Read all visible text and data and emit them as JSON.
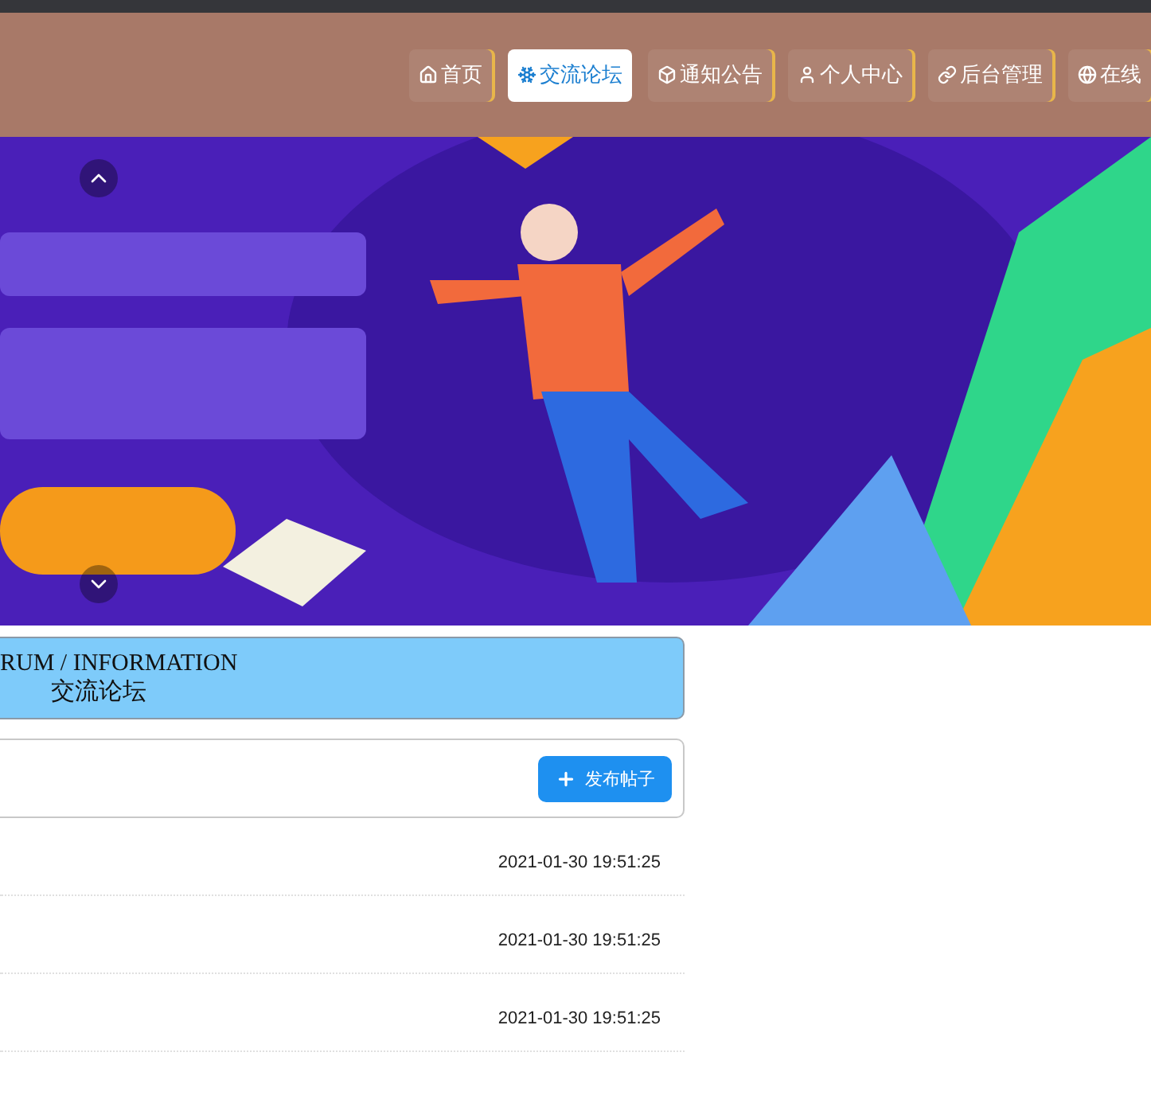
{
  "nav": [
    {
      "label": "首页",
      "selected": false
    },
    {
      "label": "交流论坛",
      "selected": true
    },
    {
      "label": "通知公告",
      "selected": false
    },
    {
      "label": "个人中心",
      "selected": false
    },
    {
      "label": "后台管理",
      "selected": false
    },
    {
      "label": "在线",
      "selected": false
    }
  ],
  "section": {
    "subtitle": "RUM / INFORMATION",
    "title": "交流论坛"
  },
  "toolbar": {
    "button": "发布帖子"
  },
  "posts": [
    {
      "time": "2021-01-30 19:51:25"
    },
    {
      "time": "2021-01-30 19:51:25"
    },
    {
      "time": "2021-01-30 19:51:25"
    }
  ]
}
